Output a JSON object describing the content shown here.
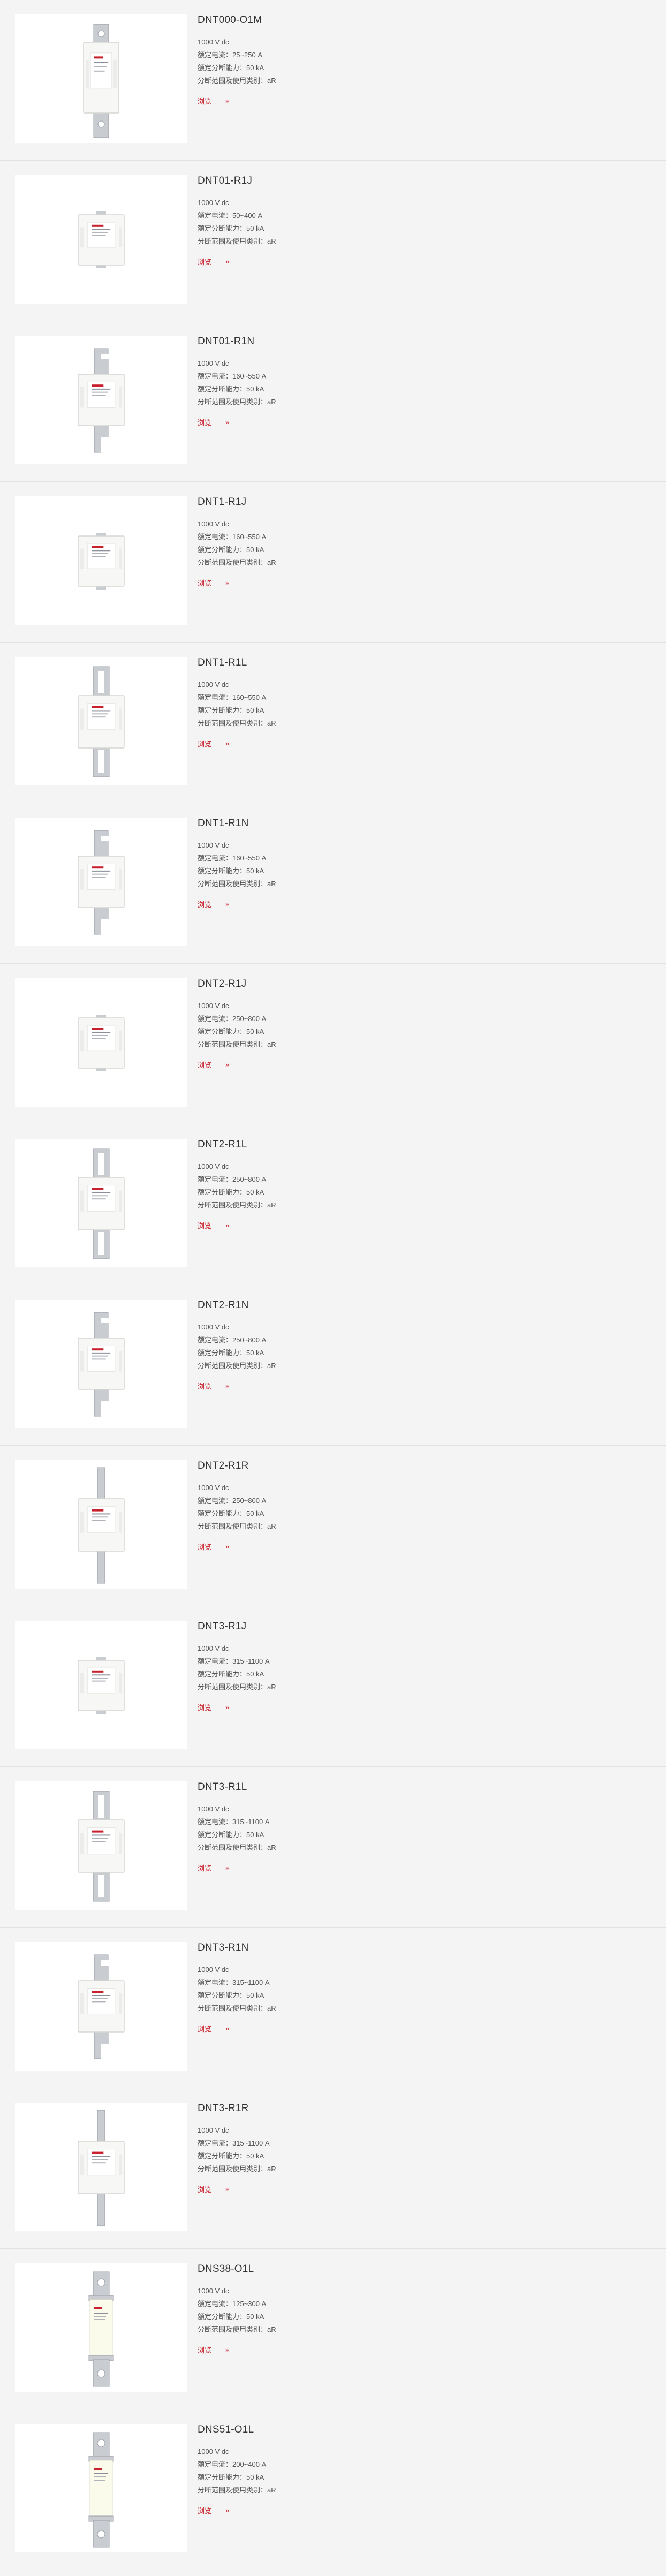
{
  "products": [
    {
      "name": "DNT000-O1M",
      "voltage": "1000 V dc",
      "current": "额定电流：25~250 A",
      "breaking": "额定分断能力：50 kA",
      "range": "分断范围及使用类别：aR",
      "shape": "tall"
    },
    {
      "name": "DNT01-R1J",
      "voltage": "1000 V dc",
      "current": "额定电流：50~400 A",
      "breaking": "额定分断能力：50 kA",
      "range": "分断范围及使用类别：aR",
      "shape": "box"
    },
    {
      "name": "DNT01-R1N",
      "voltage": "1000 V dc",
      "current": "额定电流：160~550 A",
      "breaking": "额定分断能力：50 kA",
      "range": "分断范围及使用类别：aR",
      "shape": "lug"
    },
    {
      "name": "DNT1-R1J",
      "voltage": "1000 V dc",
      "current": "额定电流：160~550 A",
      "breaking": "额定分断能力：50 kA",
      "range": "分断范围及使用类别：aR",
      "shape": "box"
    },
    {
      "name": "DNT1-R1L",
      "voltage": "1000 V dc",
      "current": "额定电流：160~550 A",
      "breaking": "额定分断能力：50 kA",
      "range": "分断范围及使用类别：aR",
      "shape": "slot"
    },
    {
      "name": "DNT1-R1N",
      "voltage": "1000 V dc",
      "current": "额定电流：160~550 A",
      "breaking": "额定分断能力：50 kA",
      "range": "分断范围及使用类别：aR",
      "shape": "lug"
    },
    {
      "name": "DNT2-R1J",
      "voltage": "1000 V dc",
      "current": "额定电流：250~800 A",
      "breaking": "额定分断能力：50 kA",
      "range": "分断范围及使用类别：aR",
      "shape": "box"
    },
    {
      "name": "DNT2-R1L",
      "voltage": "1000 V dc",
      "current": "额定电流：250~800 A",
      "breaking": "额定分断能力：50 kA",
      "range": "分断范围及使用类别：aR",
      "shape": "slot"
    },
    {
      "name": "DNT2-R1N",
      "voltage": "1000 V dc",
      "current": "额定电流：250~800 A",
      "breaking": "额定分断能力：50 kA",
      "range": "分断范围及使用类别：aR",
      "shape": "lug"
    },
    {
      "name": "DNT2-R1R",
      "voltage": "1000 V dc",
      "current": "额定电流：250~800 A",
      "breaking": "额定分断能力：50 kA",
      "range": "分断范围及使用类别：aR",
      "shape": "blade"
    },
    {
      "name": "DNT3-R1J",
      "voltage": "1000 V dc",
      "current": "额定电流：315~1100 A",
      "breaking": "额定分断能力：50 kA",
      "range": "分断范围及使用类别：aR",
      "shape": "box"
    },
    {
      "name": "DNT3-R1L",
      "voltage": "1000 V dc",
      "current": "额定电流：315~1100 A",
      "breaking": "额定分断能力：50 kA",
      "range": "分断范围及使用类别：aR",
      "shape": "slot"
    },
    {
      "name": "DNT3-R1N",
      "voltage": "1000 V dc",
      "current": "额定电流：315~1100 A",
      "breaking": "额定分断能力：50 kA",
      "range": "分断范围及使用类别：aR",
      "shape": "lug"
    },
    {
      "name": "DNT3-R1R",
      "voltage": "1000 V dc",
      "current": "额定电流：315~1100 A",
      "breaking": "额定分断能力：50 kA",
      "range": "分断范围及使用类别：aR",
      "shape": "blade"
    },
    {
      "name": "DNS38-O1L",
      "voltage": "1000 V dc",
      "current": "额定电流：125~300 A",
      "breaking": "额定分断能力：50 kA",
      "range": "分断范围及使用类别：aR",
      "shape": "cyl"
    },
    {
      "name": "DNS51-O1L",
      "voltage": "1000 V dc",
      "current": "额定电流：200~400 A",
      "breaking": "额定分断能力：50 kA",
      "range": "分断范围及使用类别：aR",
      "shape": "cyl"
    }
  ],
  "more_label": "浏览",
  "more_arrow": "»",
  "colors": {
    "accent": "#c8202c",
    "background": "#f4f4f4",
    "divider": "#e2e2e2"
  }
}
